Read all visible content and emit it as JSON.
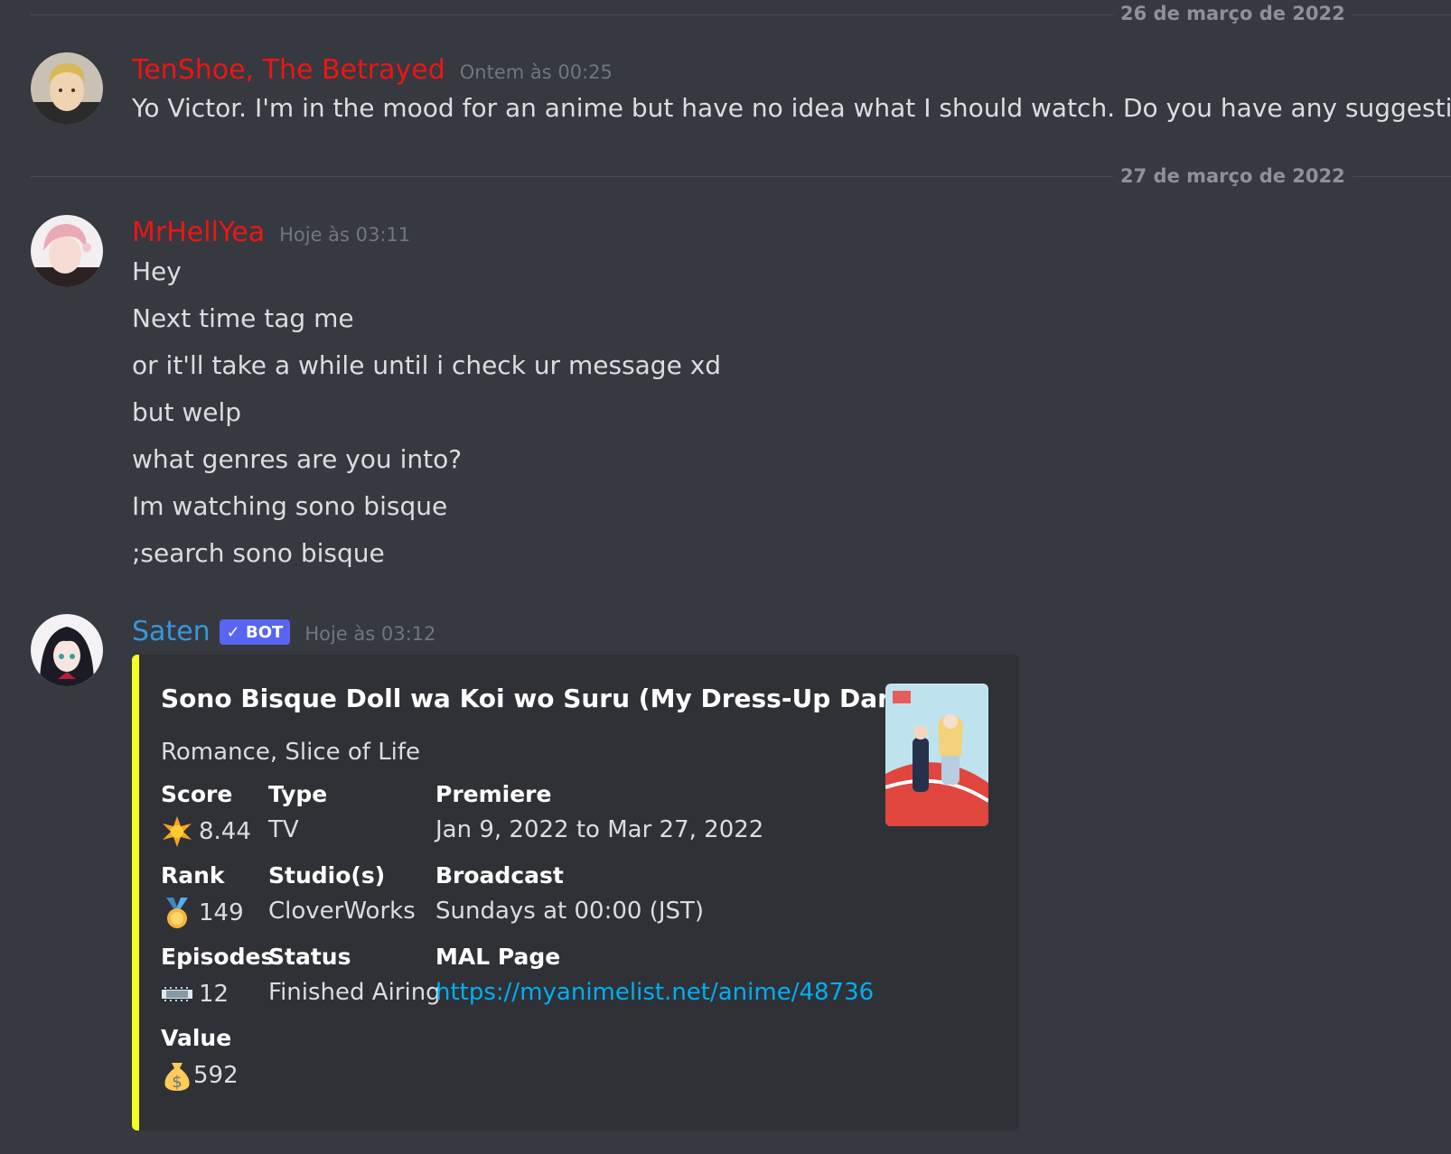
{
  "dividers": [
    {
      "date": "26 de março de 2022"
    },
    {
      "date": "27 de março de 2022"
    }
  ],
  "messages": [
    {
      "username": "TenShoe, The Betrayed",
      "username_color": "#ed1515",
      "timestamp": "Ontem às 00:25",
      "lines": [
        "Yo Victor. I'm in the mood for an anime but have no idea what I should watch. Do you have any suggestions?"
      ]
    },
    {
      "username": "MrHellYea",
      "username_color": "#ed1515",
      "timestamp": "Hoje às 03:11",
      "lines": [
        "Hey",
        "Next time tag me",
        "or it'll take a while until i check ur message xd",
        "but welp",
        "what genres are you into?",
        "Im watching sono bisque",
        ";search sono bisque"
      ]
    },
    {
      "username": "Saten",
      "username_color": "#3498db",
      "bot_tag": "✓ BOT",
      "timestamp": "Hoje às 03:12"
    }
  ],
  "embed": {
    "accent_color": "#f4ff1f",
    "title": "Sono Bisque Doll wa Koi wo Suru (My Dress-Up Darling)",
    "description": "Romance, Slice of Life",
    "fields": {
      "score": {
        "name": "Score",
        "value": "8.44",
        "icon": "star-icon"
      },
      "type": {
        "name": "Type",
        "value": "TV"
      },
      "premiere": {
        "name": "Premiere",
        "value": "Jan 9, 2022 to Mar 27, 2022"
      },
      "rank": {
        "name": "Rank",
        "value": "149",
        "icon": "medal-icon"
      },
      "studios": {
        "name": "Studio(s)",
        "value": "CloverWorks"
      },
      "broadcast": {
        "name": "Broadcast",
        "value": "Sundays at 00:00 (JST)"
      },
      "episodes": {
        "name": "Episodes",
        "value": "12",
        "icon": "film-icon"
      },
      "status": {
        "name": "Status",
        "value": "Finished Airing"
      },
      "mal": {
        "name": "MAL Page",
        "value": "https://myanimelist.net/anime/48736"
      },
      "value": {
        "name": "Value",
        "value": "592",
        "icon": "money-bag-icon"
      }
    }
  }
}
